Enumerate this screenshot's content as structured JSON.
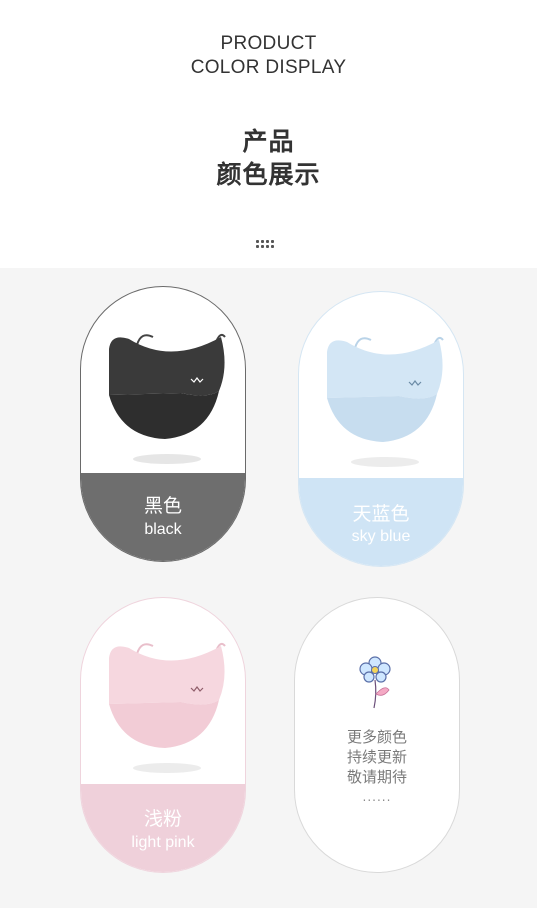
{
  "header": {
    "en_line1": "PRODUCT",
    "en_line2": "COLOR DISPLAY",
    "zh_line1": "产品",
    "zh_line2": "颜色展示"
  },
  "colors": [
    {
      "zh": "黑色",
      "en": "black",
      "mask_color": "#3d3d3d",
      "band_color": "#6e6e6e"
    },
    {
      "zh": "天蓝色",
      "en": "sky blue",
      "mask_color": "#cfe3f3",
      "band_color": "#cfe4f5"
    },
    {
      "zh": "浅粉",
      "en": "light pink",
      "mask_color": "#f6d6de",
      "band_color": "#efd0da"
    }
  ],
  "more_card": {
    "line1": "更多颜色",
    "line2": "持续更新",
    "line3": "敬请期待",
    "dots": "......"
  }
}
